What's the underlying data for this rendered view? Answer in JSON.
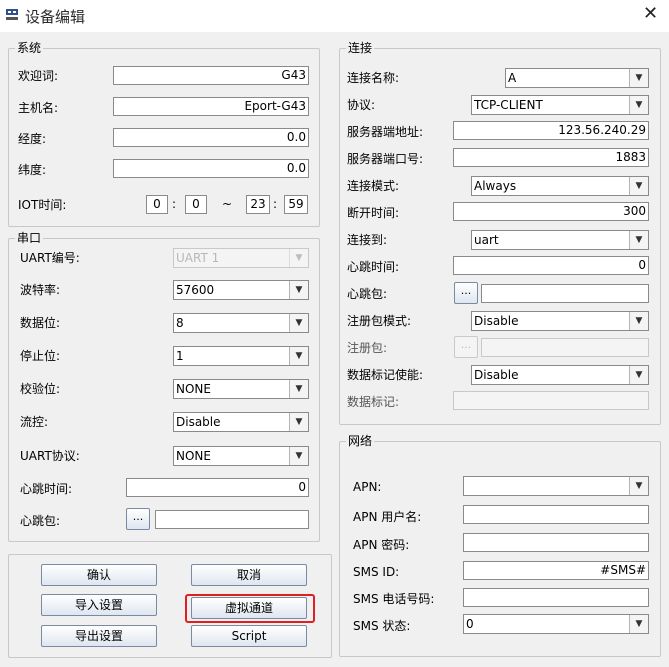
{
  "window": {
    "title": "设备编辑",
    "close_icon": "close-icon"
  },
  "system": {
    "title": "系统",
    "welcome_label": "欢迎词:",
    "welcome_value": "G43",
    "hostname_label": "主机名:",
    "hostname_value": "Eport-G43",
    "longitude_label": "经度:",
    "longitude_value": "0.0",
    "latitude_label": "纬度:",
    "latitude_value": "0.0",
    "iot_label": "IOT时间:",
    "iot_start_hour": "0",
    "iot_start_min": "0",
    "iot_end_hour": "23",
    "iot_end_min": "59",
    "tilde": "~",
    "colon": ":"
  },
  "serial": {
    "title": "串口",
    "uart_no_label": "UART编号:",
    "uart_no_value": "UART 1",
    "baud_label": "波特率:",
    "baud_value": "57600",
    "data_bits_label": "数据位:",
    "data_bits_value": "8",
    "stop_bits_label": "停止位:",
    "stop_bits_value": "1",
    "parity_label": "校验位:",
    "parity_value": "NONE",
    "flow_label": "流控:",
    "flow_value": "Disable",
    "protocol_label": "UART协议:",
    "protocol_value": "NONE",
    "heartbeat_time_label": "心跳时间:",
    "heartbeat_time_value": "0",
    "heartbeat_pkt_label": "心跳包:",
    "heartbeat_pkt_value": "",
    "browse": "..."
  },
  "connection": {
    "title": "连接",
    "name_label": "连接名称:",
    "name_value": "A",
    "protocol_label": "协议:",
    "protocol_value": "TCP-CLIENT",
    "server_addr_label": "服务器端地址:",
    "server_addr_value": "123.56.240.29",
    "server_port_label": "服务器端口号:",
    "server_port_value": "1883",
    "mode_label": "连接模式:",
    "mode_value": "Always",
    "disconnect_label": "断开时间:",
    "disconnect_value": "300",
    "connect_to_label": "连接到:",
    "connect_to_value": "uart",
    "heartbeat_time_label": "心跳时间:",
    "heartbeat_time_value": "0",
    "heartbeat_pkt_label": "心跳包:",
    "heartbeat_pkt_value": "",
    "reg_mode_label": "注册包模式:",
    "reg_mode_value": "Disable",
    "reg_pkt_label": "注册包:",
    "reg_pkt_value": "",
    "data_flag_enable_label": "数据标记使能:",
    "data_flag_enable_value": "Disable",
    "data_flag_label": "数据标记:",
    "data_flag_value": "",
    "browse": "..."
  },
  "network": {
    "title": "网络",
    "apn_label": "APN:",
    "apn_value": "",
    "apn_user_label": "APN 用户名:",
    "apn_user_value": "",
    "apn_pass_label": "APN 密码:",
    "apn_pass_value": "",
    "sms_id_label": "SMS ID:",
    "sms_id_value": "#SMS#",
    "sms_phone_label": "SMS 电话号码:",
    "sms_phone_value": "",
    "sms_state_label": "SMS 状态:",
    "sms_state_value": "0"
  },
  "buttons": {
    "confirm": "确认",
    "cancel": "取消",
    "import": "导入设置",
    "virtual_channel": "虚拟通道",
    "export": "导出设置",
    "script": "Script"
  },
  "colors": {
    "highlight": "#e02020",
    "button_border": "#7a8aa3"
  }
}
